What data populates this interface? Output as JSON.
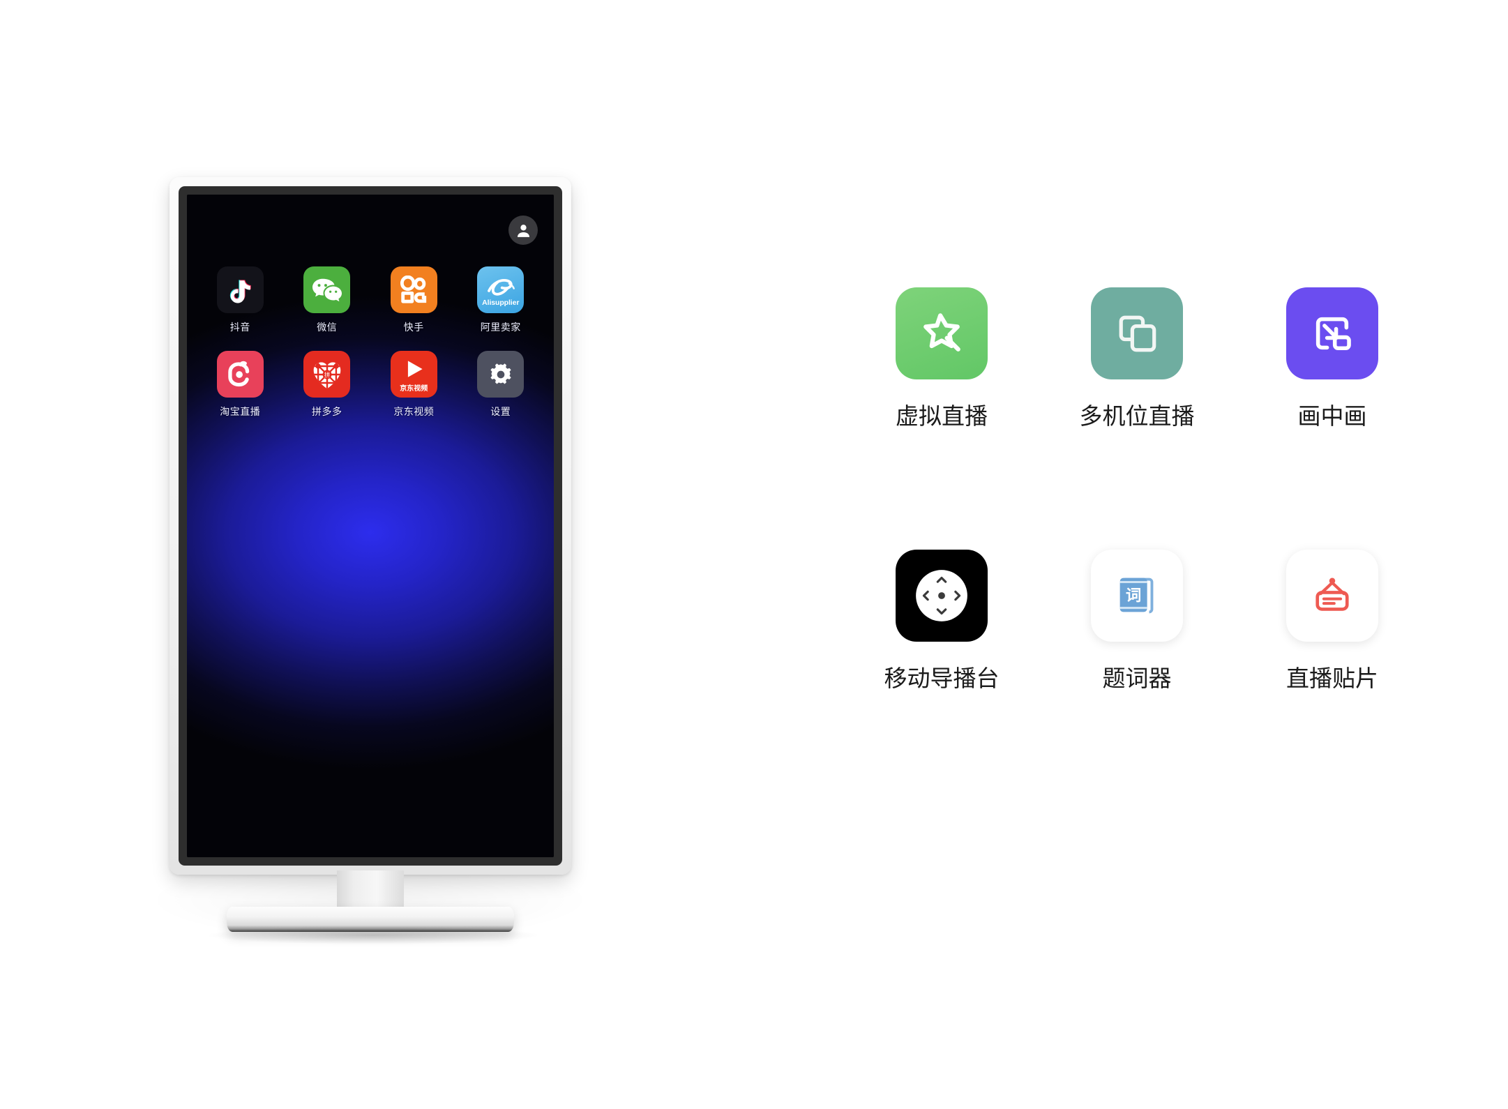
{
  "page": {
    "background_color": "#ffffff"
  },
  "monitor": {
    "name": "vertical-monitor",
    "screen": {
      "wallpaper_colors": [
        "#2d2ded",
        "#1b1b97",
        "#030308"
      ],
      "avatar": {
        "icon": "user-avatar-icon",
        "label": "用户头像"
      },
      "apps": [
        {
          "label": "抖音",
          "icon": "douyin-icon",
          "color": "#13131a"
        },
        {
          "label": "微信",
          "icon": "wechat-icon",
          "color": "#4caf3e"
        },
        {
          "label": "快手",
          "icon": "kuaishou-icon",
          "color": "#f28020"
        },
        {
          "label": "阿里卖家",
          "icon": "alisupplier-icon",
          "color": "#3ba4e2",
          "badge_text": "Alisupplier"
        },
        {
          "label": "淘宝直播",
          "icon": "taobao-live-icon",
          "color": "#e8415a"
        },
        {
          "label": "拼多多",
          "icon": "pinduoduo-icon",
          "color": "#e42b20"
        },
        {
          "label": "京东视频",
          "icon": "jd-video-icon",
          "color": "#e8301c",
          "badge_text": "京东视频"
        },
        {
          "label": "设置",
          "icon": "settings-gear-icon",
          "color": "#4e5160"
        }
      ]
    }
  },
  "features": [
    {
      "label": "虚拟直播",
      "icon": "magic-wand-star-icon",
      "color": "#62c766"
    },
    {
      "label": "多机位直播",
      "icon": "multi-window-icon",
      "color": "#6fada0"
    },
    {
      "label": "画中画",
      "icon": "picture-in-picture-icon",
      "color": "#6b4df0"
    },
    {
      "label": "移动导播台",
      "icon": "dpad-joystick-icon",
      "color": "#000000"
    },
    {
      "label": "题词器",
      "icon": "teleprompter-book-icon",
      "color": "#5b93d1"
    },
    {
      "label": "直播贴片",
      "icon": "hanging-sign-icon",
      "color": "#ee5a52"
    }
  ]
}
